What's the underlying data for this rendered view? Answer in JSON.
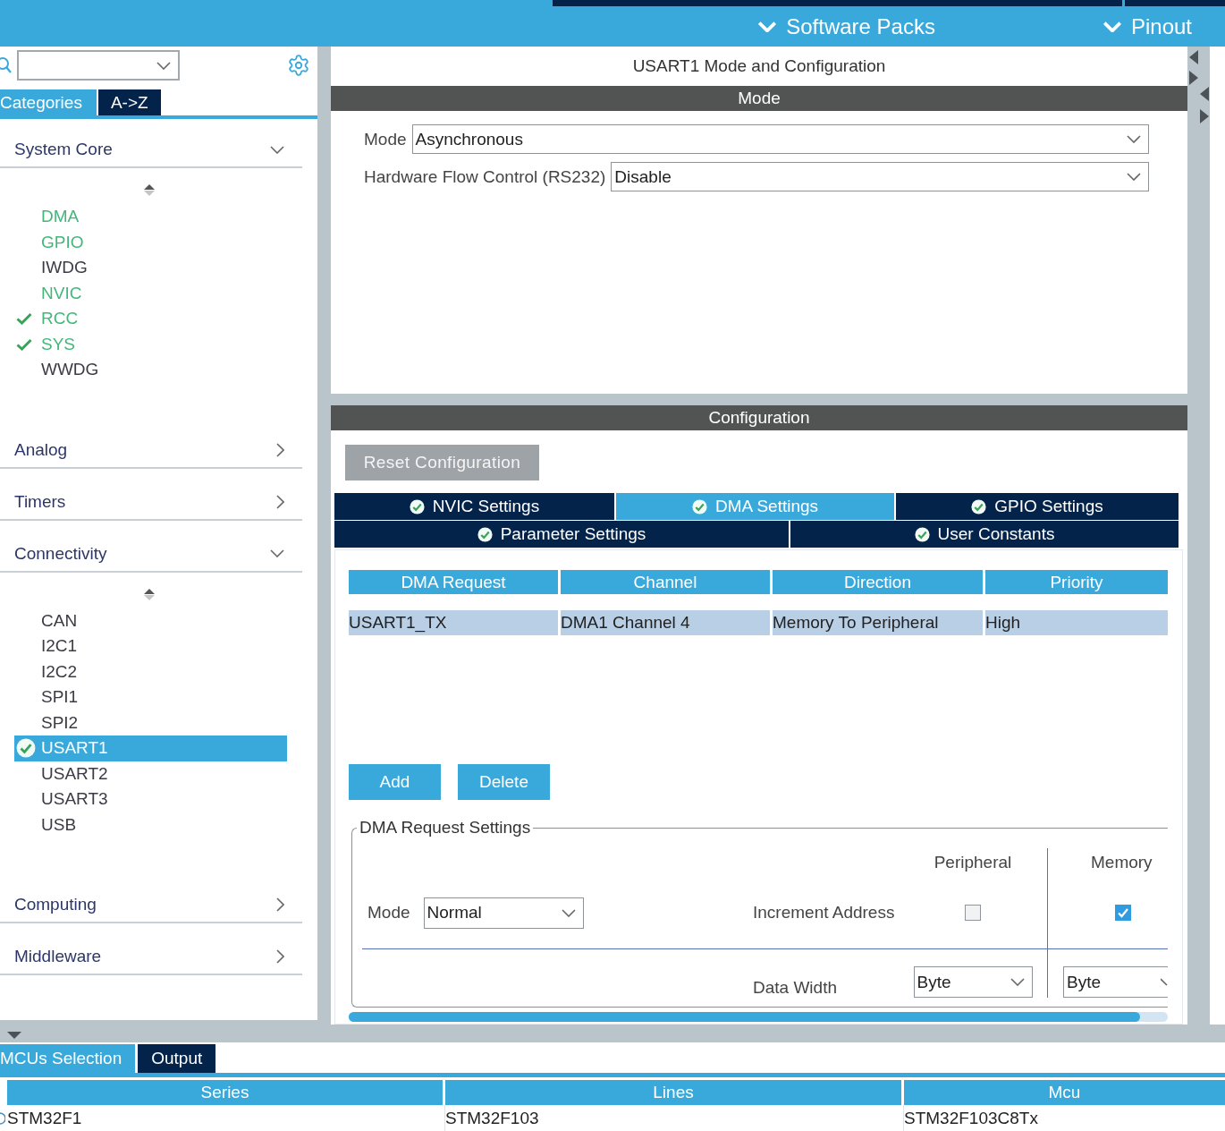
{
  "toolbar": {
    "menus": [
      {
        "label": "Software Packs"
      },
      {
        "label": "Pinout"
      }
    ]
  },
  "sidebar": {
    "tabs": [
      {
        "label": "Categories",
        "selected": true
      },
      {
        "label": "A->Z",
        "selected": false
      }
    ],
    "categories": [
      {
        "label": "System Core",
        "expanded": true,
        "items": [
          {
            "label": "DMA",
            "configured": true,
            "checked": false,
            "selected": false
          },
          {
            "label": "GPIO",
            "configured": true,
            "checked": false,
            "selected": false
          },
          {
            "label": "IWDG",
            "configured": false,
            "checked": false,
            "selected": false
          },
          {
            "label": "NVIC",
            "configured": true,
            "checked": false,
            "selected": false
          },
          {
            "label": "RCC",
            "configured": true,
            "checked": true,
            "selected": false
          },
          {
            "label": "SYS",
            "configured": true,
            "checked": true,
            "selected": false
          },
          {
            "label": "WWDG",
            "configured": false,
            "checked": false,
            "selected": false
          }
        ]
      },
      {
        "label": "Analog",
        "expanded": false
      },
      {
        "label": "Timers",
        "expanded": false
      },
      {
        "label": "Connectivity",
        "expanded": true,
        "items": [
          {
            "label": "CAN",
            "configured": false,
            "checked": false,
            "selected": false
          },
          {
            "label": "I2C1",
            "configured": false,
            "checked": false,
            "selected": false
          },
          {
            "label": "I2C2",
            "configured": false,
            "checked": false,
            "selected": false
          },
          {
            "label": "SPI1",
            "configured": false,
            "checked": false,
            "selected": false
          },
          {
            "label": "SPI2",
            "configured": false,
            "checked": false,
            "selected": false
          },
          {
            "label": "USART1",
            "configured": true,
            "checked": true,
            "selected": true
          },
          {
            "label": "USART2",
            "configured": false,
            "checked": false,
            "selected": false
          },
          {
            "label": "USART3",
            "configured": false,
            "checked": false,
            "selected": false
          },
          {
            "label": "USB",
            "configured": false,
            "checked": false,
            "selected": false
          }
        ]
      },
      {
        "label": "Computing",
        "expanded": false
      },
      {
        "label": "Middleware",
        "expanded": false
      }
    ]
  },
  "panel": {
    "title": "USART1 Mode and Configuration",
    "mode": {
      "title": "Mode",
      "fields": [
        {
          "label": "Mode",
          "value": "Asynchronous"
        },
        {
          "label": "Hardware Flow Control (RS232)",
          "value": "Disable"
        }
      ]
    },
    "configuration": {
      "title": "Configuration",
      "reset_button": "Reset Configuration",
      "tab_rows": [
        {
          "tabs": [
            {
              "label": "NVIC Settings",
              "selected": false,
              "checked": true
            },
            {
              "label": "DMA Settings",
              "selected": true,
              "checked": true
            },
            {
              "label": "GPIO Settings",
              "selected": false,
              "checked": true
            }
          ]
        },
        {
          "tabs": [
            {
              "label": "Parameter Settings",
              "selected": false,
              "checked": true
            },
            {
              "label": "User Constants",
              "selected": false,
              "checked": true
            }
          ]
        }
      ],
      "dma_table": {
        "columns": [
          "DMA Request",
          "Channel",
          "Direction",
          "Priority"
        ],
        "rows": [
          {
            "cells": [
              "USART1_TX",
              "DMA1 Channel 4",
              "Memory To Peripheral",
              "High"
            ],
            "selected": true
          }
        ]
      },
      "buttons": [
        "Add",
        "Delete"
      ],
      "request_settings": {
        "title": "DMA Request Settings",
        "columns": [
          "Peripheral",
          "Memory"
        ],
        "mode": {
          "label": "Mode",
          "value": "Normal"
        },
        "increment_address": {
          "label": "Increment Address",
          "peripheral": {
            "checked": false
          },
          "memory": {
            "checked": true
          }
        },
        "data_width": {
          "label": "Data Width",
          "peripheral": "Byte",
          "memory": "Byte"
        }
      }
    }
  },
  "bottom_panel": {
    "tabs": [
      {
        "label": "MCUs Selection",
        "selected": true
      },
      {
        "label": "Output",
        "selected": false
      }
    ],
    "table": {
      "columns": [
        "Series",
        "Lines",
        "Mcu"
      ],
      "rows": [
        {
          "cells": [
            "STM32F1",
            "STM32F103",
            "STM32F103C8Tx"
          ]
        }
      ]
    }
  }
}
